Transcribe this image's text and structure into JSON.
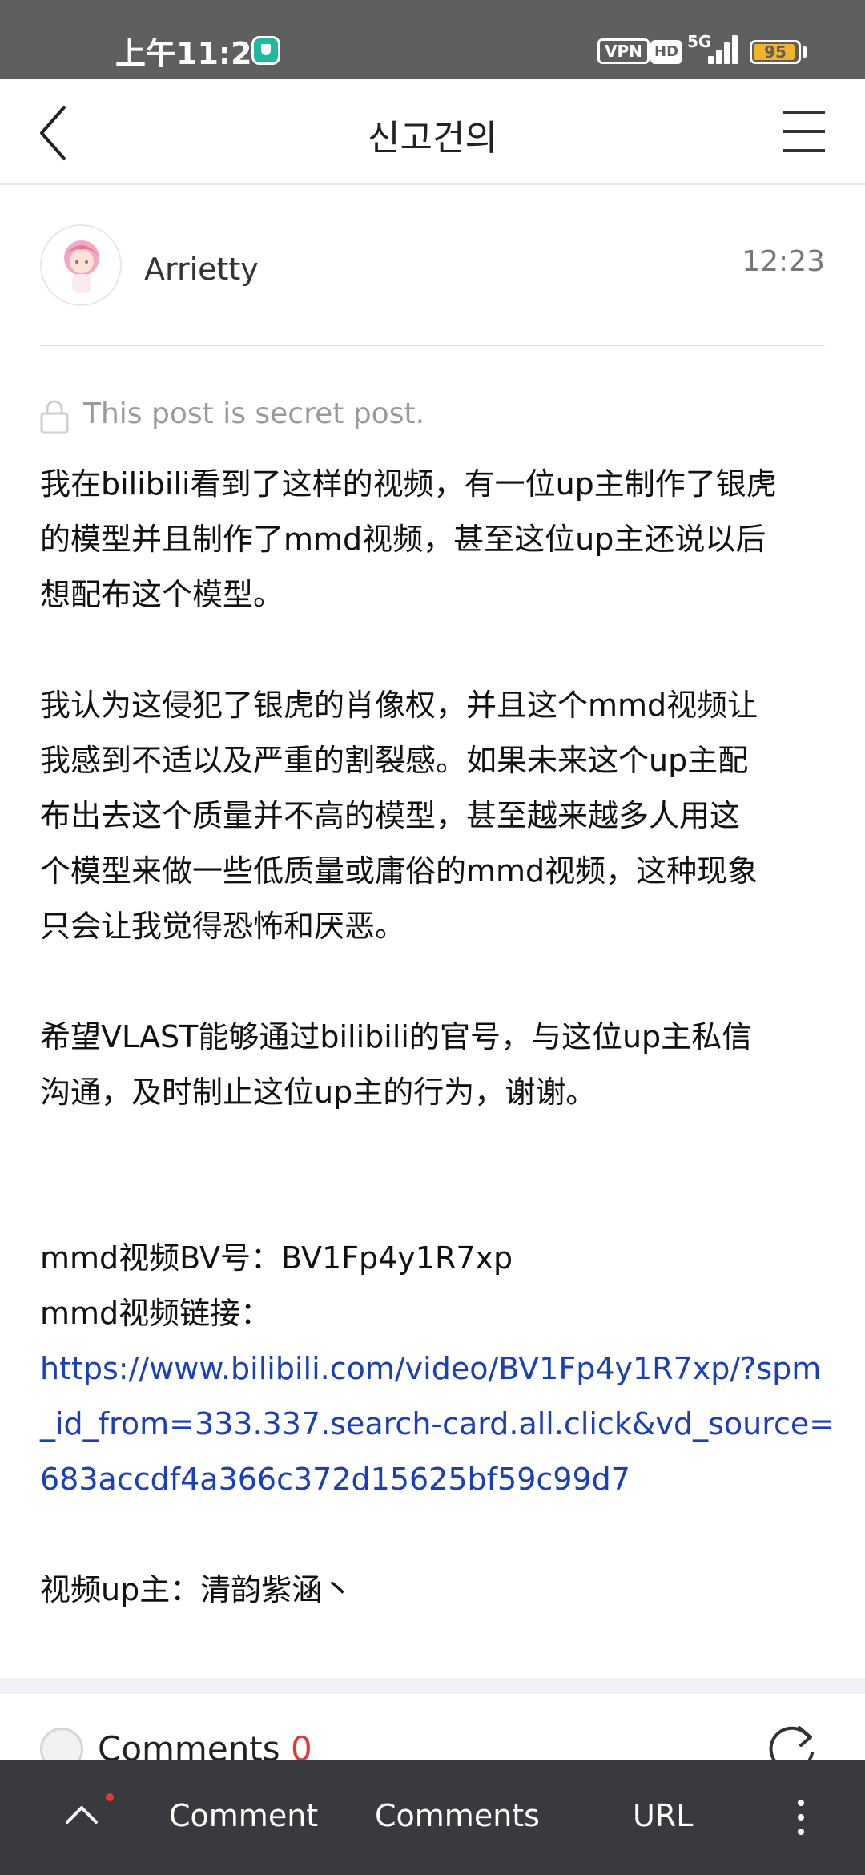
{
  "status_bar": {
    "time": "上午11:28",
    "vpn": "VPN",
    "hd": "HD",
    "network": "5G",
    "battery": "95",
    "battery_level": 0.95,
    "icons": [
      "security-shield-icon",
      "vpn-icon",
      "hd-icon",
      "signal-icon",
      "battery-icon"
    ]
  },
  "header": {
    "title": "신고건의",
    "icons": [
      "back-arrow-icon",
      "menu-icon"
    ]
  },
  "author": {
    "name": "Arrietty",
    "time": "12:23"
  },
  "secret_notice": "This post is secret post.",
  "post": {
    "p1": [
      "我在bilibili看到了这样的视频，有一位up主制作了银虎",
      "的模型并且制作了mmd视频，甚至这位up主还说以后",
      "想配布这个模型。"
    ],
    "p2": [
      "我认为这侵犯了银虎的肖像权，并且这个mmd视频让",
      "我感到不适以及严重的割裂感。如果未来这个up主配",
      "布出去这个质量并不高的模型，甚至越来越多人用这",
      "个模型来做一些低质量或庸俗的mmd视频，这种现象",
      "只会让我觉得恐怖和厌恶。"
    ],
    "p3": [
      "希望VLAST能够通过bilibili的官号，与这位up主私信",
      "沟通，及时制止这位up主的行为，谢谢。"
    ],
    "bv_line": "mmd视频BV号：BV1Fp4y1R7xp",
    "link_label": "mmd视频链接：",
    "link": [
      "https://www.bilibili.com/video/BV1Fp4y1R7xp/?spm",
      "_id_from=333.337.search-card.all.click&vd_source=",
      "683accdf4a366c372d15625bf59c99d7"
    ],
    "uploader_line": "视频up主：清韵紫涵丶"
  },
  "comments": {
    "label": "Comments",
    "count": "0"
  },
  "bottom_bar": {
    "comment": "Comment",
    "comments": "Comments",
    "url": "URL"
  },
  "colors": {
    "status_bar_bg": "#5f5f5f",
    "bottom_bar_bg": "#3a3a3e",
    "link": "#1b3fb8",
    "comment_count": "#e03a3a",
    "battery": "#f0b429"
  }
}
